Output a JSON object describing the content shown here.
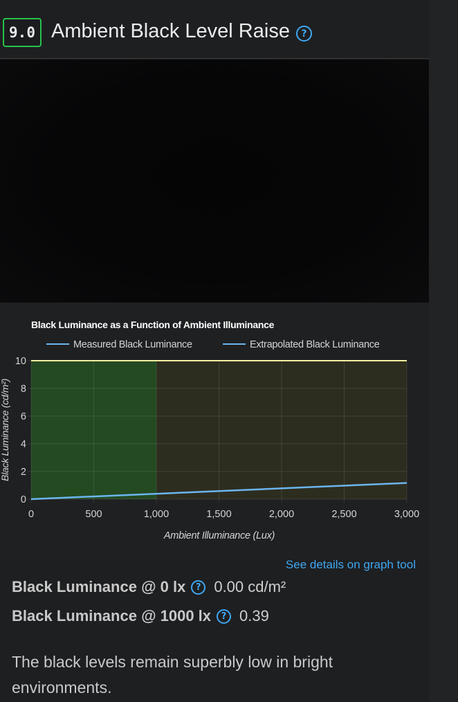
{
  "header": {
    "score": "9.0",
    "title": "Ambient Black Level Raise"
  },
  "colors": {
    "score_border": "#27c24c",
    "link": "#3fa7f0",
    "line": "#6bb6ef",
    "green_zone": "#244a22",
    "yellow_zone": "#2d2d1f",
    "top_line": "#f4f0a0"
  },
  "chart_data": {
    "type": "line",
    "title": "Black Luminance as a Function of Ambient Illuminance",
    "xlabel": "Ambient Illuminance (Lux)",
    "ylabel": "Black Luminance (cd/m²)",
    "xlim": [
      0,
      3000
    ],
    "ylim": [
      0,
      10
    ],
    "x_ticks": [
      "0",
      "500",
      "1,000",
      "1,500",
      "2,000",
      "2,500",
      "3,000"
    ],
    "y_ticks": [
      "0",
      "2",
      "4",
      "6",
      "8",
      "10"
    ],
    "legend_position": "top",
    "grid": true,
    "zones": [
      {
        "from": 0,
        "to": 1000,
        "color": "green"
      },
      {
        "from": 1000,
        "to": 3000,
        "color": "yellow"
      }
    ],
    "series": [
      {
        "name": "Measured Black Luminance",
        "x": [
          0,
          1000
        ],
        "y": [
          0.0,
          0.39
        ]
      },
      {
        "name": "Extrapolated Black Luminance",
        "x": [
          1000,
          3000
        ],
        "y": [
          0.39,
          1.17
        ]
      }
    ]
  },
  "link": {
    "label": "See details on graph tool"
  },
  "metrics": [
    {
      "label": "Black Luminance @ 0 lx",
      "value": "0.00 cd/m²"
    },
    {
      "label": "Black Luminance @ 1000 lx",
      "value": "0.39"
    }
  ],
  "verdict": "The black levels remain superbly low in bright environments."
}
